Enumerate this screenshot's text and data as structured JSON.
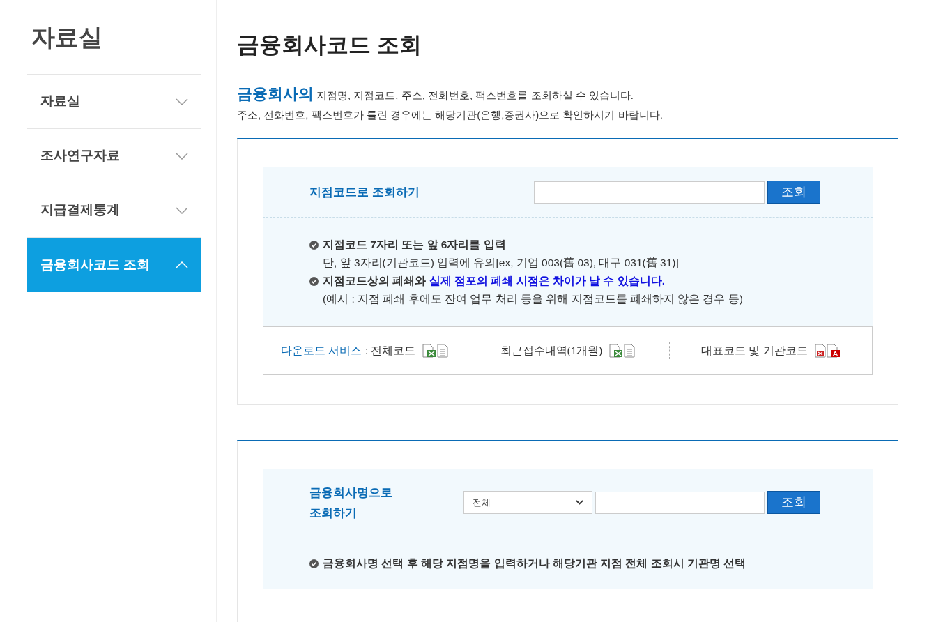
{
  "sidebar": {
    "title": "자료실",
    "items": [
      {
        "label": "자료실",
        "selected": false,
        "expanded": false
      },
      {
        "label": "조사연구자료",
        "selected": false,
        "expanded": false
      },
      {
        "label": "지급결제통계",
        "selected": false,
        "expanded": false
      },
      {
        "label": "금융회사코드 조회",
        "selected": true,
        "expanded": true
      }
    ]
  },
  "page_title": "금융회사코드 조회",
  "intro": {
    "lead": "금융회사의",
    "line_1": "지점명, 지점코드, 주소, 전화번호, 팩스번호를 조회하실 수 있습니다.",
    "line_2": "주소, 전화번호, 팩스번호가 틀린 경우에는 해당기관(은행,증권사)으로 확인하시기 바랍니다."
  },
  "branch_search": {
    "label": "지점코드로 조회하기",
    "button": "조회",
    "notes": [
      {
        "text": "지점코드 7자리 또는 앞 6자리를 입력",
        "detail": "단, 앞 3자리(기관코드) 입력에 유의[ex, 기업 003(舊 03), 대구 031(舊 31)]"
      },
      {
        "text": "지점코드상의 폐쇄와",
        "highlight": "실제 점포의 폐쇄 시점은 차이가 날 수 있습니다.",
        "detail": "(예시 : 지점 폐쇄 후에도 잔여 업무 처리 등을 위해 지점코드를 폐쇄하지 않은 경우 등)"
      }
    ],
    "downloads": [
      {
        "lead": "다운로드 서비스",
        "label": " : 전체코드",
        "kind": "excel"
      },
      {
        "label": "최근접수내역(1개월)",
        "kind": "excel"
      },
      {
        "label": "대표코드 및 기관코드",
        "kind": "pdf"
      }
    ]
  },
  "name_search": {
    "label_line_1": "금융회사명으로",
    "label_line_2": "조회하기",
    "select": "전체",
    "button": "조회",
    "notes": [
      "금융회사명 선택 후 해당 지점명을 입력하거나 해당기관 지점 전체 조회시 기관명 선택"
    ]
  }
}
